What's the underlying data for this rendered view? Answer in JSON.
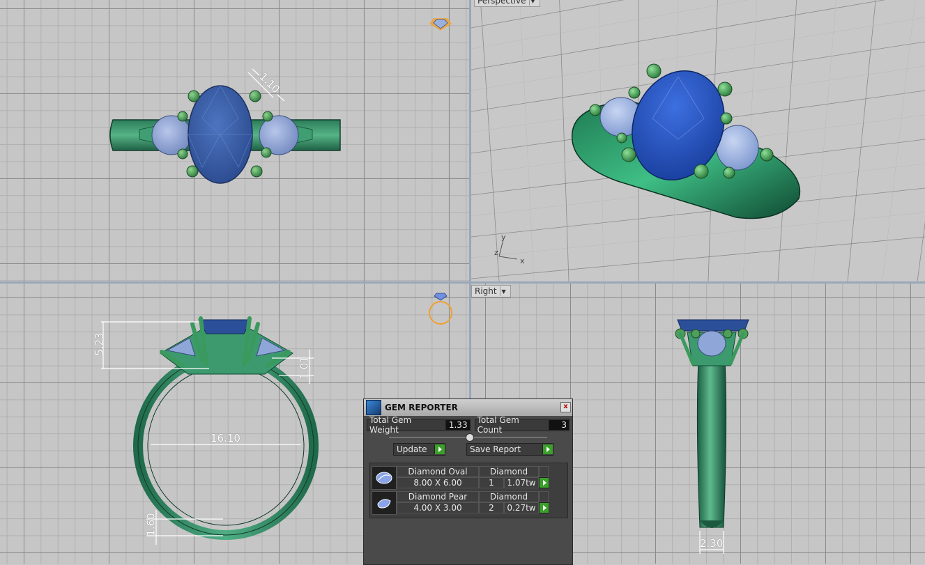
{
  "viewports": {
    "perspective_label": "Perspective",
    "right_label": "Right",
    "axes": {
      "x": "x",
      "y": "y",
      "z": "z"
    }
  },
  "dimensions": {
    "top_prong": "1.10",
    "front_height": "5.23",
    "front_gap": "1.01",
    "front_inner_diameter": "16.10",
    "front_shank": "1.60",
    "right_shank": "2.30"
  },
  "gem_reporter": {
    "title": "GEM REPORTER",
    "close": "x",
    "total_weight_label": "Total Gem Weight",
    "total_weight_value": "1.33",
    "total_count_label": "Total Gem Count",
    "total_count_value": "3",
    "update_label": "Update",
    "save_report_label": "Save Report",
    "gems": [
      {
        "shape": "Diamond Oval",
        "material": "Diamond",
        "size": "8.00 X 6.00",
        "count": "1",
        "weight": "1.07tw"
      },
      {
        "shape": "Diamond Pear",
        "material": "Diamond",
        "size": "4.00 X 3.00",
        "count": "2",
        "weight": "0.27tw"
      }
    ]
  },
  "colors": {
    "metal": "#2e8a63",
    "gem_center": "#2f5aa8",
    "gem_side": "#8fa6d8",
    "prong": "#4f9f5a",
    "accent_icon": "#f0a030"
  }
}
